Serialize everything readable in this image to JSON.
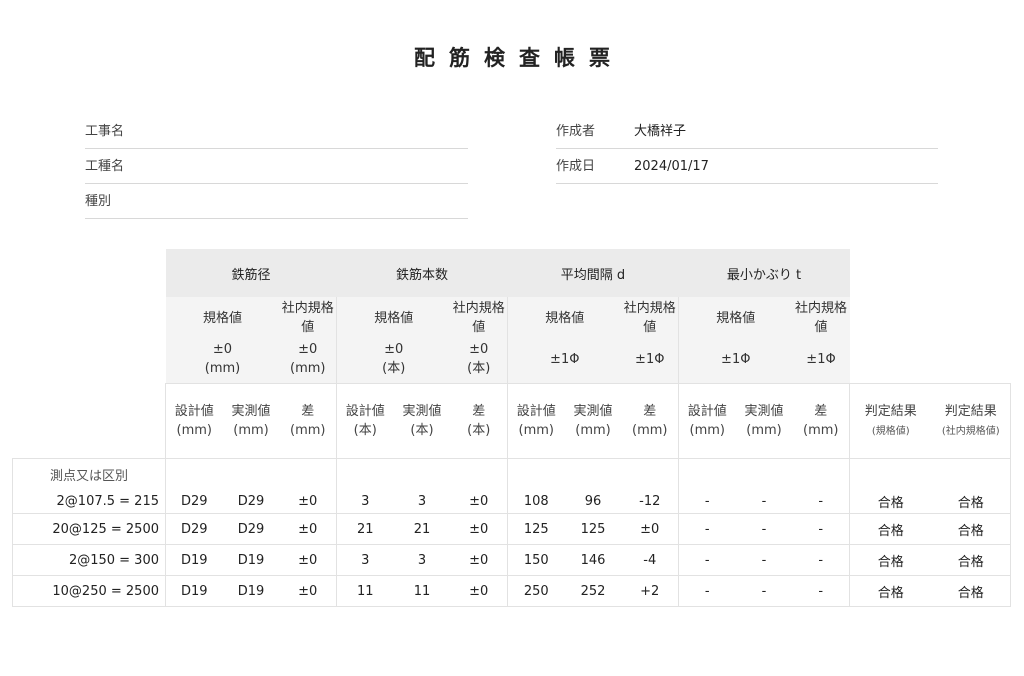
{
  "title": "配筋検査帳票",
  "info_left": [
    {
      "label": "工事名",
      "value": ""
    },
    {
      "label": "工種名",
      "value": ""
    },
    {
      "label": "種別",
      "value": ""
    }
  ],
  "info_right": [
    {
      "label": "作成者",
      "value": "大橋祥子"
    },
    {
      "label": "作成日",
      "value": "2024/01/17"
    }
  ],
  "groups": [
    "鉄筋径",
    "鉄筋本数",
    "平均間隔 d",
    "最小かぶり t"
  ],
  "std_labels": {
    "standard": "規格値",
    "internal": "社内規格値"
  },
  "std_values": [
    {
      "standard": "±0",
      "standard_unit": "(mm)",
      "internal": "±0",
      "internal_unit": "(mm)"
    },
    {
      "standard": "±0",
      "standard_unit": "(本)",
      "internal": "±0",
      "internal_unit": "(本)"
    },
    {
      "standard": "±1Φ",
      "standard_unit": "",
      "internal": "±1Φ",
      "internal_unit": ""
    },
    {
      "standard": "±1Φ",
      "standard_unit": "",
      "internal": "±1Φ",
      "internal_unit": ""
    }
  ],
  "col_headers": {
    "design": "設計値",
    "actual": "実測値",
    "diff": "差",
    "units": [
      "(mm)",
      "(本)",
      "(mm)",
      "(mm)"
    ],
    "judge": "判定結果",
    "judge_std": "(規格値)",
    "judge_internal": "(社内規格値)"
  },
  "row_group_label": "測点又は区別",
  "rows": [
    {
      "label": "2@107.5 = 215",
      "cells": [
        "D29",
        "D29",
        "±0",
        "3",
        "3",
        "±0",
        "108",
        "96",
        "-12",
        "-",
        "-",
        "-",
        "合格",
        "合格"
      ]
    },
    {
      "label": "20@125 = 2500",
      "cells": [
        "D29",
        "D29",
        "±0",
        "21",
        "21",
        "±0",
        "125",
        "125",
        "±0",
        "-",
        "-",
        "-",
        "合格",
        "合格"
      ]
    },
    {
      "label": "2@150 = 300",
      "cells": [
        "D19",
        "D19",
        "±0",
        "3",
        "3",
        "±0",
        "150",
        "146",
        "-4",
        "-",
        "-",
        "-",
        "合格",
        "合格"
      ]
    },
    {
      "label": "10@250 = 2500",
      "cells": [
        "D19",
        "D19",
        "±0",
        "11",
        "11",
        "±0",
        "250",
        "252",
        "+2",
        "-",
        "-",
        "-",
        "合格",
        "合格"
      ]
    }
  ]
}
